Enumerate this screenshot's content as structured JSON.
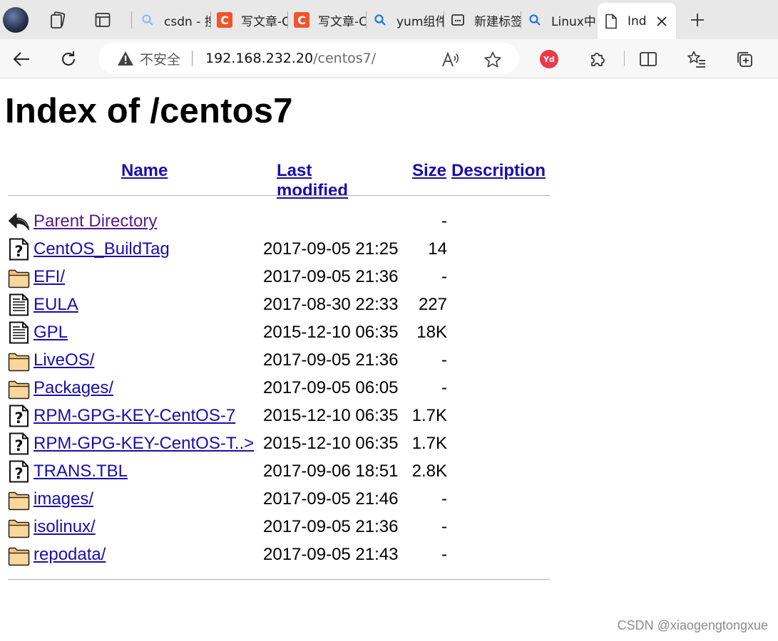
{
  "browser": {
    "tabs": [
      {
        "title": "csdn - 搜",
        "favicon": "search-icon"
      },
      {
        "title": "写文章-C",
        "favicon": "csdn-c-icon"
      },
      {
        "title": "写文章-C",
        "favicon": "csdn-c-icon"
      },
      {
        "title": "yum组件",
        "favicon": "search-icon"
      },
      {
        "title": "新建标签",
        "favicon": "new-tab-icon"
      },
      {
        "title": "Linux中",
        "favicon": "search-icon"
      },
      {
        "title": "Ind",
        "favicon": "page-icon",
        "active": true
      }
    ],
    "address": {
      "insecure_label": "不安全",
      "host": "192.168.232.20",
      "path": "/centos7/"
    },
    "extension_label": "Yd",
    "colors": {
      "link": "#1a0dab",
      "visited": "#551a8b",
      "csdn": "#f0542d",
      "yd": "#ea3a4b"
    }
  },
  "page": {
    "title": "Index of /centos7",
    "columns": {
      "name": "Name",
      "last_modified": "Last modified",
      "size": "Size",
      "description": "Description"
    },
    "rows": [
      {
        "name": "Parent Directory",
        "date": "",
        "size": "-",
        "icon": "back-arrow-icon",
        "visited": true
      },
      {
        "name": "CentOS_BuildTag",
        "date": "2017-09-05 21:25",
        "size": "14",
        "icon": "unknown-file-icon"
      },
      {
        "name": "EFI/",
        "date": "2017-09-05 21:36",
        "size": "-",
        "icon": "folder-icon"
      },
      {
        "name": "EULA",
        "date": "2017-08-30 22:33",
        "size": "227",
        "icon": "text-file-icon"
      },
      {
        "name": "GPL",
        "date": "2015-12-10 06:35",
        "size": "18K",
        "icon": "text-file-icon"
      },
      {
        "name": "LiveOS/",
        "date": "2017-09-05 21:36",
        "size": "-",
        "icon": "folder-icon"
      },
      {
        "name": "Packages/",
        "date": "2017-09-05 06:05",
        "size": "-",
        "icon": "folder-icon"
      },
      {
        "name": "RPM-GPG-KEY-CentOS-7",
        "date": "2015-12-10 06:35",
        "size": "1.7K",
        "icon": "unknown-file-icon"
      },
      {
        "name": "RPM-GPG-KEY-CentOS-T..>",
        "date": "2015-12-10 06:35",
        "size": "1.7K",
        "icon": "unknown-file-icon"
      },
      {
        "name": "TRANS.TBL",
        "date": "2017-09-06 18:51",
        "size": "2.8K",
        "icon": "unknown-file-icon"
      },
      {
        "name": "images/",
        "date": "2017-09-05 21:46",
        "size": "-",
        "icon": "folder-icon"
      },
      {
        "name": "isolinux/",
        "date": "2017-09-05 21:36",
        "size": "-",
        "icon": "folder-icon"
      },
      {
        "name": "repodata/",
        "date": "2017-09-05 21:43",
        "size": "-",
        "icon": "folder-icon"
      }
    ]
  },
  "watermark": "CSDN @xiaogengtongxue"
}
